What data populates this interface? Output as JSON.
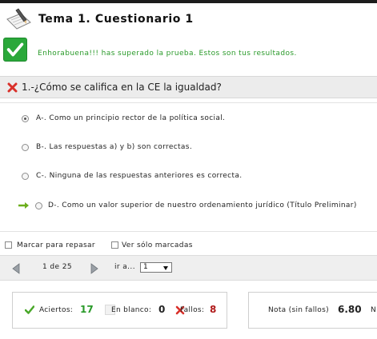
{
  "header": {
    "title": "Tema 1. Cuestionario 1"
  },
  "result": {
    "message": "Enhorabuena!!! has superado la prueba. Estos son tus resultados."
  },
  "question": {
    "text": "1.-¿Cómo se califica en la CE la igualdad?"
  },
  "options": [
    {
      "label": "A-. Como un principio rector de la política social.",
      "selected": true,
      "correct": false
    },
    {
      "label": "B-. Las respuestas a) y b) son correctas.",
      "selected": false,
      "correct": false
    },
    {
      "label": "C-. Ninguna de las respuestas anteriores es correcta.",
      "selected": false,
      "correct": false
    },
    {
      "label": "D-. Como un valor superior de nuestro ordenamiento jurídico (Título Preliminar)",
      "selected": false,
      "correct": true
    }
  ],
  "controls": {
    "mark_label": "Marcar para repasar",
    "show_marked_label": "Ver sólo marcadas"
  },
  "pager": {
    "pages": "1 de 25",
    "goto_label": "ir a...",
    "goto_value": "1"
  },
  "stats": {
    "correct_label": "Aciertos:",
    "correct_value": "17",
    "blank_label": "En blanco:",
    "blank_value": "0",
    "fail_label": "Fallos:",
    "fail_value": "8"
  },
  "grade": {
    "label": "Nota (sin fallos)",
    "value": "6.80",
    "cut_text": "N"
  },
  "colors": {
    "success_green": "#2aa83a",
    "correct_green": "#2a9a2a",
    "fail_red": "#b01a1a",
    "wrong_x": "#d9302a"
  }
}
